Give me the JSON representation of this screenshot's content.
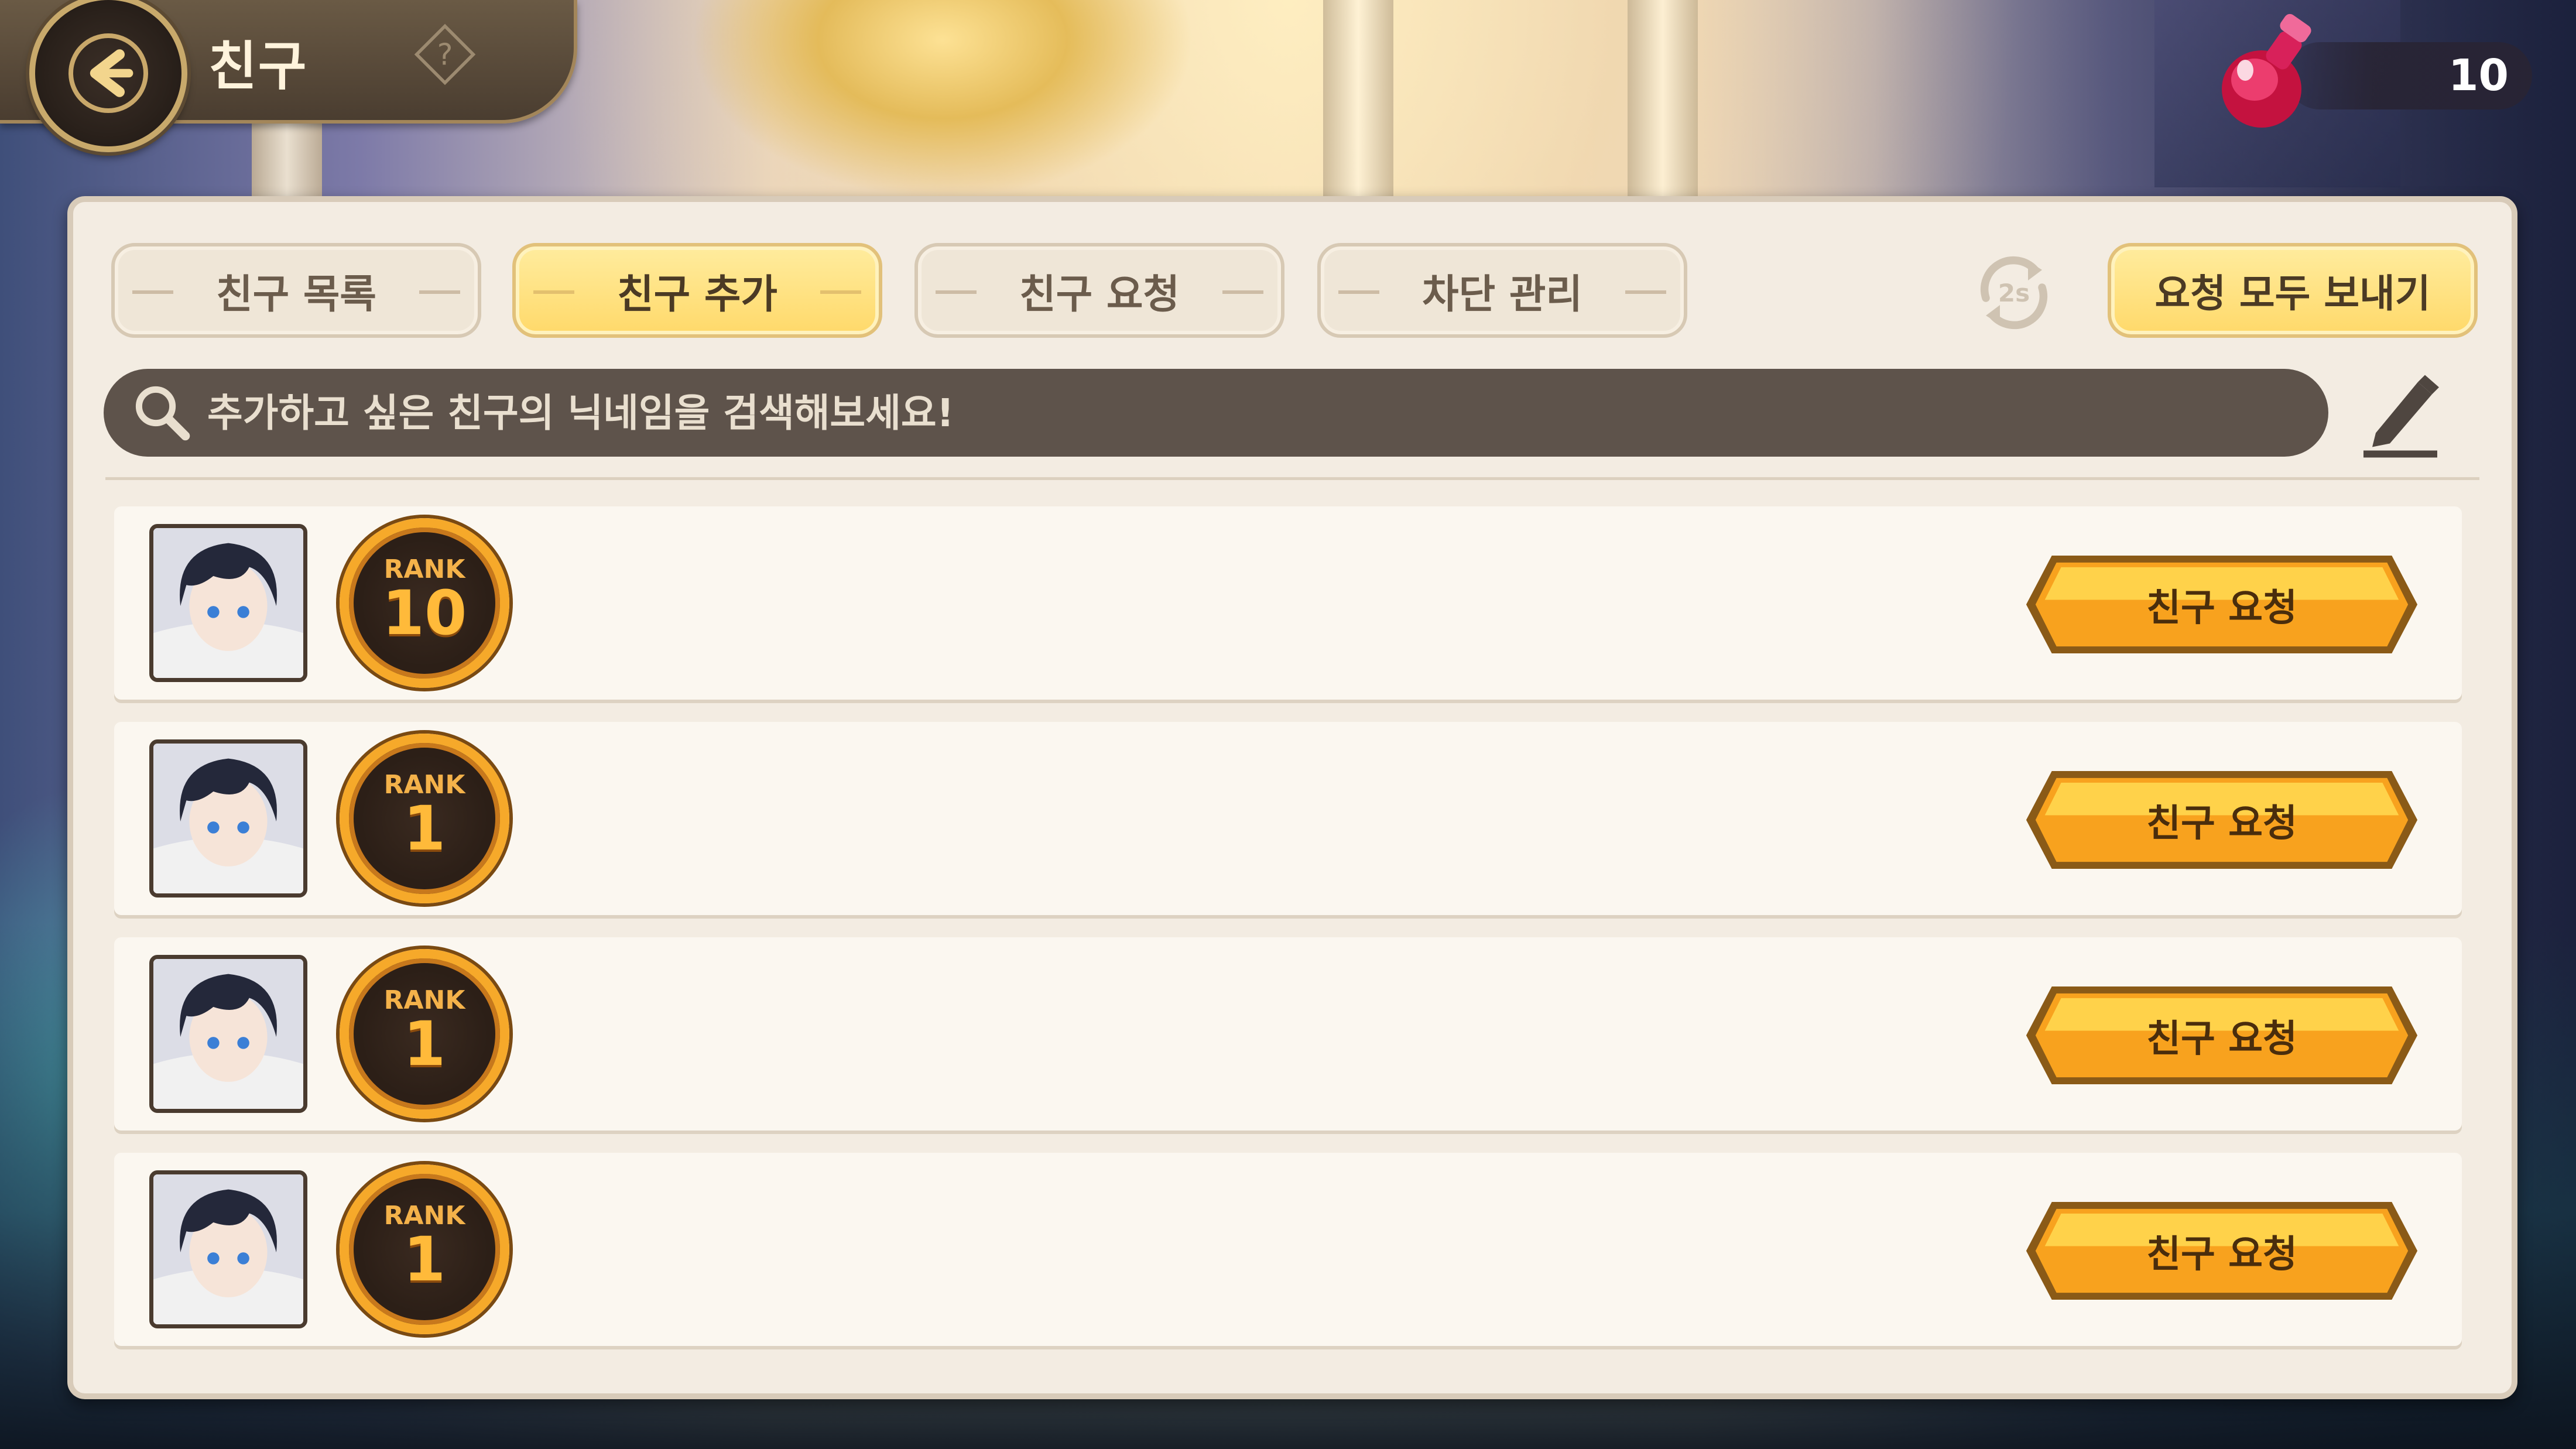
{
  "header": {
    "title": "친구",
    "back_icon": "back-arrow-icon",
    "help_icon": "question-mark-icon"
  },
  "currency": {
    "icon": "potion-icon",
    "value": "10"
  },
  "tabs": [
    {
      "label": "친구 목록",
      "active": false
    },
    {
      "label": "친구 추가",
      "active": true
    },
    {
      "label": "친구 요청",
      "active": false
    },
    {
      "label": "차단 관리",
      "active": false
    }
  ],
  "toolbar": {
    "refresh_label": "2s",
    "send_all_label": "요청 모두 보내기"
  },
  "search": {
    "placeholder": "추가하고 싶은 친구의 닉네임을 검색해보세요!",
    "value": ""
  },
  "friends": [
    {
      "rank_label": "RANK",
      "rank": "10",
      "nickname": "",
      "button_label": "친구 요청"
    },
    {
      "rank_label": "RANK",
      "rank": "1",
      "nickname": "",
      "button_label": "친구 요청"
    },
    {
      "rank_label": "RANK",
      "rank": "1",
      "nickname": "",
      "button_label": "친구 요청"
    },
    {
      "rank_label": "RANK",
      "rank": "1",
      "nickname": "",
      "button_label": "친구 요청"
    }
  ],
  "colors": {
    "accent_yellow": "#ffd96a",
    "button_orange": "#f8a21e",
    "panel_bg": "#f3ece2",
    "search_bg": "#5e534b"
  }
}
